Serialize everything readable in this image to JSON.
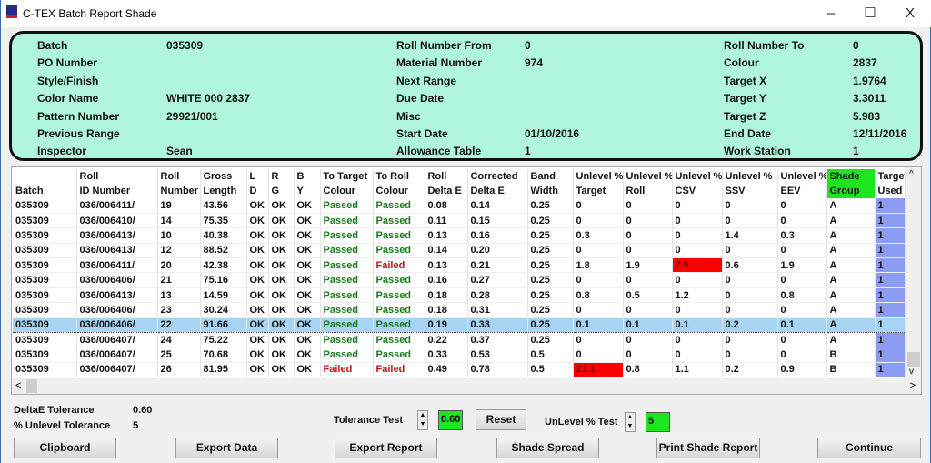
{
  "window": {
    "title": "C-TEX Batch Report Shade",
    "minimize": "–",
    "maximize": "☐",
    "close": "X"
  },
  "info": [
    [
      {
        "label": "Batch",
        "value": "035309"
      },
      {
        "label": "Roll Number From",
        "value": "0"
      },
      {
        "label": "Roll Number To",
        "value": "0"
      }
    ],
    [
      {
        "label": "PO Number",
        "value": ""
      },
      {
        "label": "Material Number",
        "value": "974"
      },
      {
        "label": "Colour",
        "value": "2837"
      }
    ],
    [
      {
        "label": "Style/Finish",
        "value": ""
      },
      {
        "label": "Next Range",
        "value": ""
      },
      {
        "label": "Target X",
        "value": "1.9764"
      }
    ],
    [
      {
        "label": "Color Name",
        "value": "WHITE 000 2837"
      },
      {
        "label": "Due Date",
        "value": ""
      },
      {
        "label": "Target Y",
        "value": "3.3011"
      }
    ],
    [
      {
        "label": "Pattern Number",
        "value": "29921/001"
      },
      {
        "label": "Misc",
        "value": ""
      },
      {
        "label": "Target Z",
        "value": "5.983"
      }
    ],
    [
      {
        "label": "Previous Range",
        "value": ""
      },
      {
        "label": "Start Date",
        "value": "01/10/2016"
      },
      {
        "label": "End Date",
        "value": "12/11/2016"
      }
    ],
    [
      {
        "label": "Inspector",
        "value": "Sean"
      },
      {
        "label": "Allowance Table",
        "value": "1"
      },
      {
        "label": "Work Station",
        "value": "1"
      }
    ]
  ],
  "table": {
    "headers1": [
      "",
      "Roll",
      "Roll",
      "Gross",
      "L",
      "R",
      "B",
      "To Target",
      "To Roll",
      "Roll",
      "Corrected",
      "Band",
      "Unlevel %",
      "Unlevel %",
      "Unlevel %",
      "Unlevel %",
      "Unlevel %",
      "Shade",
      "Target"
    ],
    "headers2": [
      "Batch",
      "ID Number",
      "Number",
      "Length",
      "D",
      "G",
      "Y",
      "Colour",
      "Colour",
      "Delta E",
      "Delta E",
      "Width",
      "Target",
      "Roll",
      "CSV",
      "SSV",
      "EEV",
      "Group",
      "Used"
    ],
    "rows": [
      [
        "035309",
        "036/006411/",
        "19",
        "43.56",
        "OK",
        "OK",
        "OK",
        "Passed",
        "Passed",
        "0.08",
        "0.14",
        "0.25",
        "0",
        "0",
        "0",
        "0",
        "0",
        "A",
        "1"
      ],
      [
        "035309",
        "036/006410/",
        "14",
        "75.35",
        "OK",
        "OK",
        "OK",
        "Passed",
        "Passed",
        "0.11",
        "0.15",
        "0.25",
        "0",
        "0",
        "0",
        "0",
        "0",
        "A",
        "1"
      ],
      [
        "035309",
        "036/006413/",
        "10",
        "40.38",
        "OK",
        "OK",
        "OK",
        "Passed",
        "Passed",
        "0.13",
        "0.16",
        "0.25",
        "0.3",
        "0",
        "0",
        "1.4",
        "0.3",
        "A",
        "1"
      ],
      [
        "035309",
        "036/006413/",
        "12",
        "88.52",
        "OK",
        "OK",
        "OK",
        "Passed",
        "Passed",
        "0.14",
        "0.20",
        "0.25",
        "0",
        "0",
        "0",
        "0",
        "0",
        "A",
        "1"
      ],
      [
        "035309",
        "036/006411/",
        "20",
        "42.38",
        "OK",
        "OK",
        "OK",
        "Passed",
        "Failed",
        "0.13",
        "0.21",
        "0.25",
        "1.8",
        "1.9",
        "7.5",
        "0.6",
        "1.9",
        "A",
        "1"
      ],
      [
        "035309",
        "036/006406/",
        "21",
        "75.16",
        "OK",
        "OK",
        "OK",
        "Passed",
        "Passed",
        "0.16",
        "0.27",
        "0.25",
        "0",
        "0",
        "0",
        "0",
        "0",
        "A",
        "1"
      ],
      [
        "035309",
        "036/006413/",
        "13",
        "14.59",
        "OK",
        "OK",
        "OK",
        "Passed",
        "Passed",
        "0.18",
        "0.28",
        "0.25",
        "0.8",
        "0.5",
        "1.2",
        "0",
        "0.8",
        "A",
        "1"
      ],
      [
        "035309",
        "036/006406/",
        "23",
        "30.24",
        "OK",
        "OK",
        "OK",
        "Passed",
        "Passed",
        "0.18",
        "0.31",
        "0.25",
        "0",
        "0",
        "0",
        "0",
        "0",
        "A",
        "1"
      ],
      [
        "035309",
        "036/006406/",
        "22",
        "91.66",
        "OK",
        "OK",
        "OK",
        "Passed",
        "Passed",
        "0.19",
        "0.33",
        "0.25",
        "0.1",
        "0.1",
        "0.1",
        "0.2",
        "0.1",
        "A",
        "1"
      ],
      [
        "035309",
        "036/006407/",
        "24",
        "75.22",
        "OK",
        "OK",
        "OK",
        "Passed",
        "Passed",
        "0.22",
        "0.37",
        "0.25",
        "0",
        "0",
        "0",
        "0",
        "0",
        "A",
        "1"
      ],
      [
        "035309",
        "036/006407/",
        "25",
        "70.68",
        "OK",
        "OK",
        "OK",
        "Passed",
        "Passed",
        "0.33",
        "0.53",
        "0.5",
        "0",
        "0",
        "0",
        "0",
        "0",
        "B",
        "1"
      ],
      [
        "035309",
        "036/006407/",
        "26",
        "81.95",
        "OK",
        "OK",
        "OK",
        "Failed",
        "Failed",
        "0.49",
        "0.78",
        "0.5",
        "21.1",
        "0.8",
        "1.1",
        "0.2",
        "0.9",
        "B",
        "1"
      ]
    ],
    "selected_row": 8,
    "flagged_cells": [
      [
        4,
        14
      ],
      [
        11,
        12
      ]
    ]
  },
  "colors": {
    "panel": "#aff6dc",
    "passed": "#1f7a1f",
    "failed": "#c0101a",
    "flag": "#ff0000",
    "shade_header": "#1ee61e",
    "target_used": "#8c9cf0",
    "selected": "#a8d4f4"
  },
  "tolerance": {
    "deltae_label": "DeltaE Tolerance",
    "deltae_value": "0.60",
    "unlevel_label": "% Unlevel Tolerance",
    "unlevel_value": "5"
  },
  "tests": {
    "tolerance_label": "Tolerance Test",
    "tolerance_value": "0.60",
    "reset": "Reset",
    "unlevel_label": "UnLevel % Test",
    "unlevel_value": "5",
    "up": "▲",
    "down": "▼"
  },
  "buttons": {
    "clipboard": "Clipboard",
    "export_data": "Export Data",
    "export_report": "Export Report",
    "shade_spread": "Shade Spread",
    "print": "Print Shade Report",
    "continue": "Continue"
  },
  "scroll": {
    "up": "^",
    "down": "v",
    "left": "<",
    "right": ">"
  }
}
